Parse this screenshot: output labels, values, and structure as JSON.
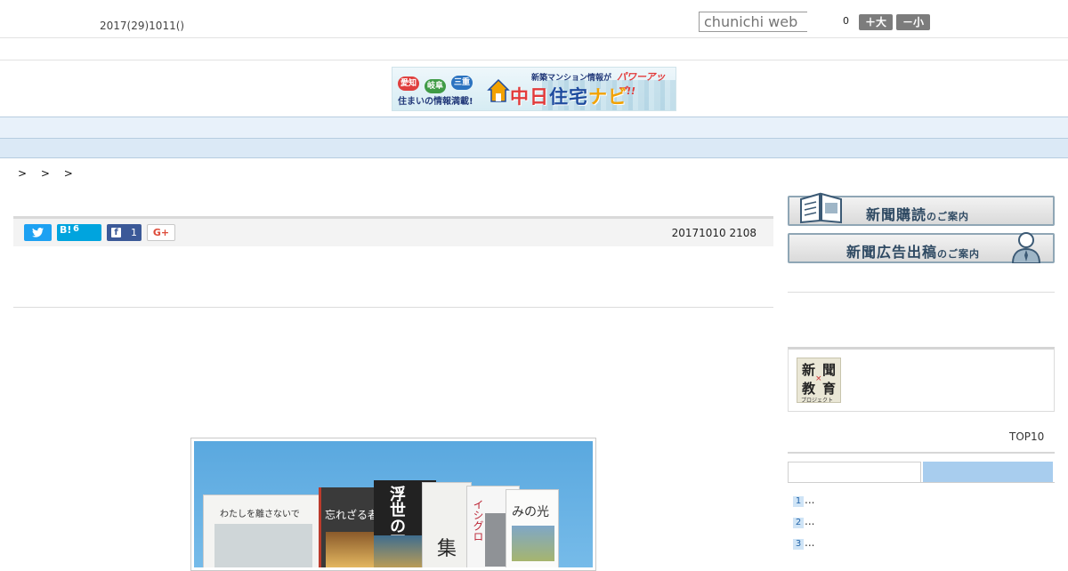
{
  "header": {
    "date": "2017(29)1011()",
    "search_placeholder": "chunichi web",
    "font_level": "0",
    "font_plus_label": "＋大",
    "font_minus_label": "－小"
  },
  "banner": {
    "pills": [
      "愛知",
      "岐阜",
      "三重"
    ],
    "tagline": "住まいの情報満載!",
    "top_text": "新築マンション情報が",
    "top_text2": "パワーアップ!!",
    "logo_a": "中日",
    "logo_b": "住宅",
    "logo_c": "ナビ"
  },
  "nav": {
    "items": [
      "    ",
      "    ",
      "    ",
      "    ",
      "    ",
      "    ",
      "    ",
      "    ",
      "    "
    ]
  },
  "breadcrumb": ">  >  >",
  "article": {
    "twitter_label": "",
    "hatena_mark": "B!",
    "hatena_count": "6",
    "facebook_count": "1",
    "gplus_label": "G+",
    "date": "20171010 2108",
    "books": [
      {
        "title": "わたしを離さないで"
      },
      {
        "title": "忘れざる者"
      },
      {
        "title": "浮世の画家"
      },
      {
        "title": "集"
      },
      {
        "title": "イシグロ"
      },
      {
        "title": "みの光"
      }
    ]
  },
  "sidebar": {
    "subscribe_main": "新聞購読",
    "subscribe_sub": "のご案内",
    "advert_main": "新聞広告出稿",
    "advert_sub": "のご案内",
    "edu": {
      "c1": "新",
      "c2": "聞",
      "c3": "教",
      "c4": "育",
      "x": "×",
      "project": "プロジェクト"
    },
    "top10_label": "TOP10",
    "ranking": [
      {
        "num": "1",
        "text": "..."
      },
      {
        "num": "2",
        "text": "..."
      },
      {
        "num": "3",
        "text": "..."
      }
    ]
  },
  "colors": {
    "nav_bg": "#e8f1fa",
    "tab_active": "#a8cdee",
    "twitter": "#1da1f2",
    "hatena": "#00a4de",
    "facebook": "#3b5998"
  }
}
